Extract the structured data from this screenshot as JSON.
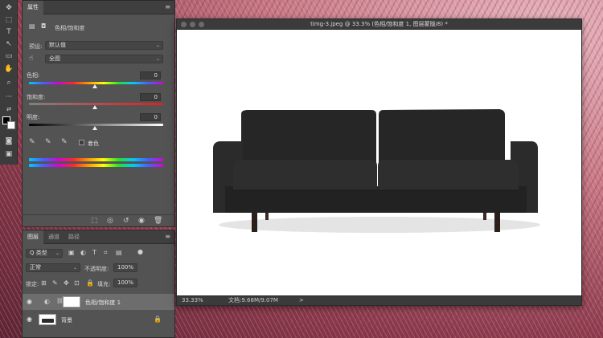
{
  "document": {
    "title": "timg-3.jpeg @ 33.3% (色相/饱和度 1, 图层蒙版/8) *",
    "zoom": "33.33%",
    "doc_size": "文档:9.68M/9.07M",
    "status_arrow": ">"
  },
  "properties_panel": {
    "tab_label": "属性",
    "menu_icon": "≡",
    "collapse_icon": "»",
    "adjustment_title": "色相/饱和度",
    "preset_label": "预设:",
    "preset_value": "默认值",
    "channel_value": "全图",
    "hue_label": "色相:",
    "hue_value": "0",
    "saturation_label": "饱和度:",
    "saturation_value": "0",
    "lightness_label": "明度:",
    "lightness_value": "0",
    "colorize_label": "着色"
  },
  "layers_panel": {
    "tabs": [
      "图层",
      "通道",
      "路径"
    ],
    "filter_label": "Q 类型",
    "blend_mode": "正常",
    "opacity_label": "不透明度:",
    "opacity_value": "100%",
    "lock_label": "锁定:",
    "fill_label": "填充:",
    "fill_value": "100%",
    "layers": [
      {
        "name": "色相/饱和度 1",
        "selected": true
      },
      {
        "name": "背景",
        "selected": false
      }
    ]
  },
  "colors": {
    "panel_bg": "#535353",
    "tabbar_bg": "#3f3f3f",
    "canvas_bg": "#ffffff",
    "sofa": "#2a2a2a"
  },
  "icons": {
    "tools": [
      "move-icon",
      "marquee-icon",
      "type-icon",
      "path-select-icon",
      "rectangle-icon",
      "hand-icon",
      "zoom-icon",
      "more-icon"
    ]
  }
}
